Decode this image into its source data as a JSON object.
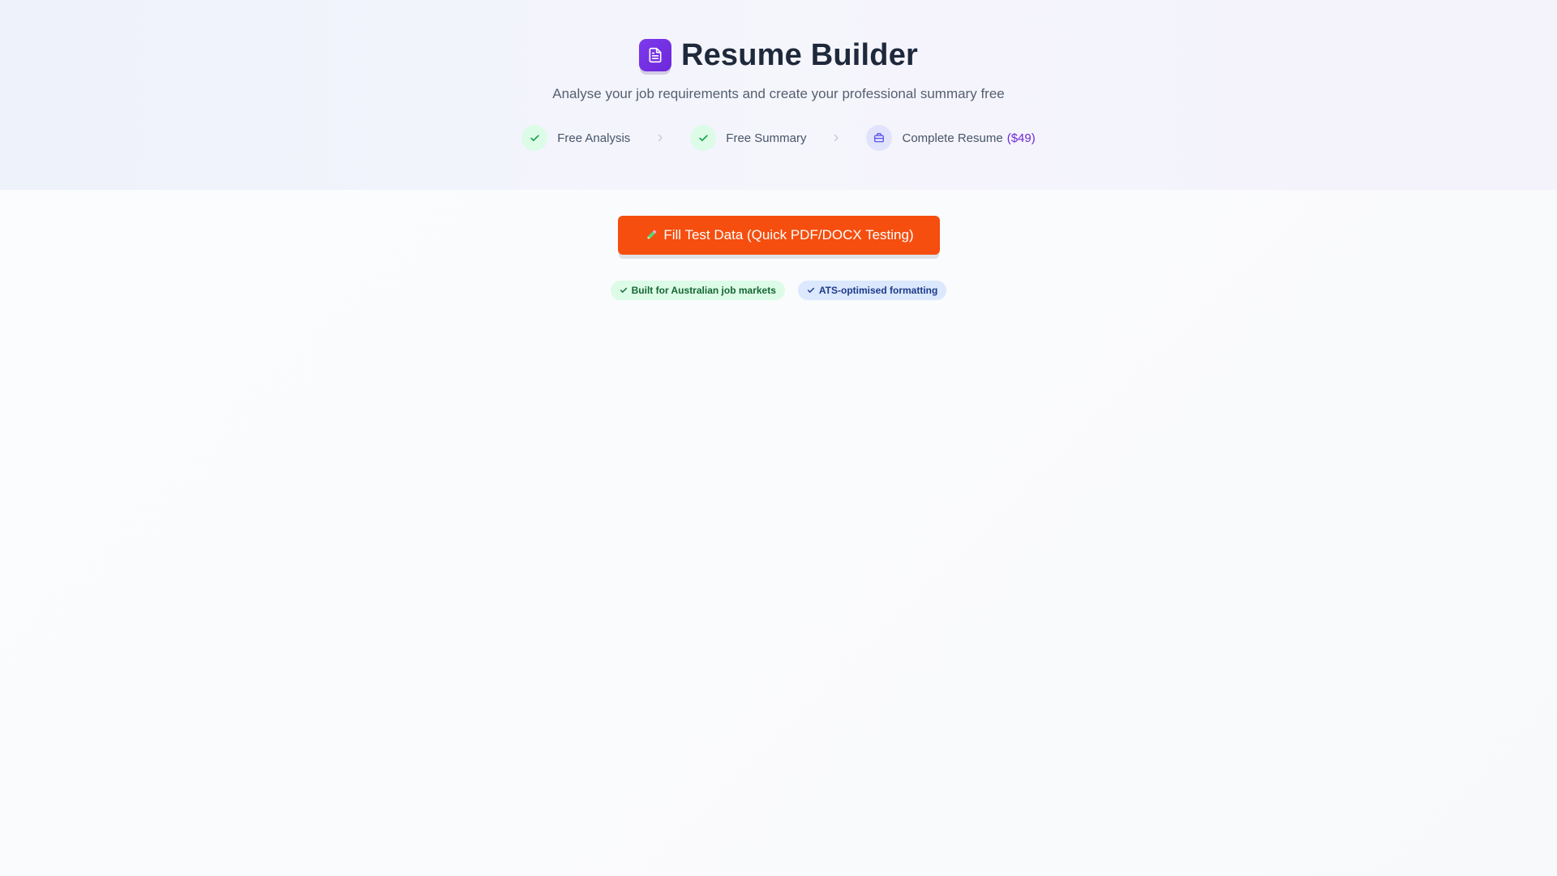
{
  "header": {
    "title": "Resume Builder",
    "subtitle": "Analyse your job requirements and create your professional summary free",
    "logo_icon": "document-icon"
  },
  "steps": [
    {
      "label": "Free Analysis",
      "icon": "check-icon",
      "status": "done"
    },
    {
      "label": "Free Summary",
      "icon": "check-icon",
      "status": "done"
    },
    {
      "label": "Complete Resume",
      "price": "($49)",
      "icon": "briefcase-icon",
      "status": "locked"
    }
  ],
  "cta": {
    "icon": "pencil-icon",
    "label": "Fill Test Data (Quick PDF/DOCX Testing)"
  },
  "badges": [
    {
      "label": "Built for Australian job markets",
      "icon": "check-icon"
    },
    {
      "label": "ATS-optimised formatting",
      "icon": "check-icon"
    }
  ],
  "colors": {
    "accent_purple": "#7c3aed",
    "cta_orange": "#f54e0f",
    "success_green": "#16a34a",
    "price_purple": "#6d28d9"
  }
}
